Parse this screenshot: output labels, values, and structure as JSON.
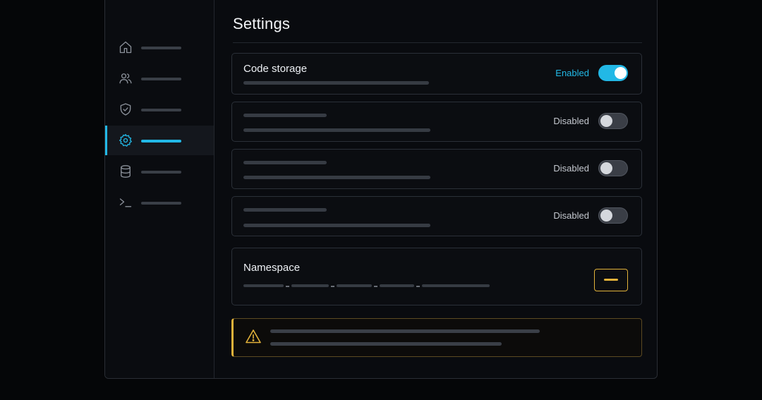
{
  "page": {
    "title": "Settings"
  },
  "sidebar": {
    "items": [
      {
        "icon": "home-icon",
        "active": false
      },
      {
        "icon": "users-icon",
        "active": false
      },
      {
        "icon": "shield-icon",
        "active": false
      },
      {
        "icon": "gear-icon",
        "active": true
      },
      {
        "icon": "database-icon",
        "active": false
      },
      {
        "icon": "terminal-icon",
        "active": false
      }
    ]
  },
  "settings": [
    {
      "label": "Code storage",
      "status": "Enabled",
      "enabled": true
    },
    {
      "label": "",
      "status": "Disabled",
      "enabled": false
    },
    {
      "label": "",
      "status": "Disabled",
      "enabled": false
    },
    {
      "label": "",
      "status": "Disabled",
      "enabled": false
    }
  ],
  "namespace": {
    "label": "Namespace"
  },
  "warning": {
    "icon": "warning-icon"
  },
  "colors": {
    "accent": "#22b8e6",
    "warning": "#e2b23a",
    "background": "#090b0f"
  }
}
